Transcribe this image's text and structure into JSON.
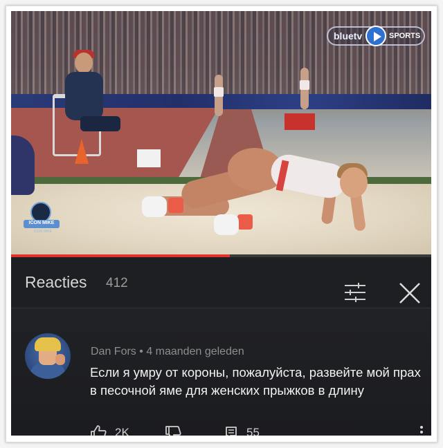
{
  "video": {
    "watermark_logo": {
      "part1": "bluetv",
      "part2": "SPORTS",
      "icon": "play-icon"
    },
    "badge": {
      "label": "ICON MIKE",
      "sub": "ICON MIKE",
      "icon": "microphone-icon"
    },
    "progress_fraction": 0.52,
    "colors": {
      "progress": "#e0342a",
      "track": "#3a3a3a"
    }
  },
  "reactions": {
    "title": "Reacties",
    "count": "412",
    "filter_icon": "sliders-icon",
    "close_icon": "close-icon"
  },
  "comment": {
    "author": "Dan Fors",
    "separator": "•",
    "time": "4 maanden geleden",
    "text": "Если я умру от короны, пожалуйста, развейте мой прах в песочной яме для женских прыжков в длину",
    "likes": "2K",
    "replies": "55",
    "icons": {
      "like": "thumbs-up-icon",
      "dislike": "thumbs-down-icon",
      "reply": "reply-icon",
      "more": "more-vertical-icon"
    }
  }
}
